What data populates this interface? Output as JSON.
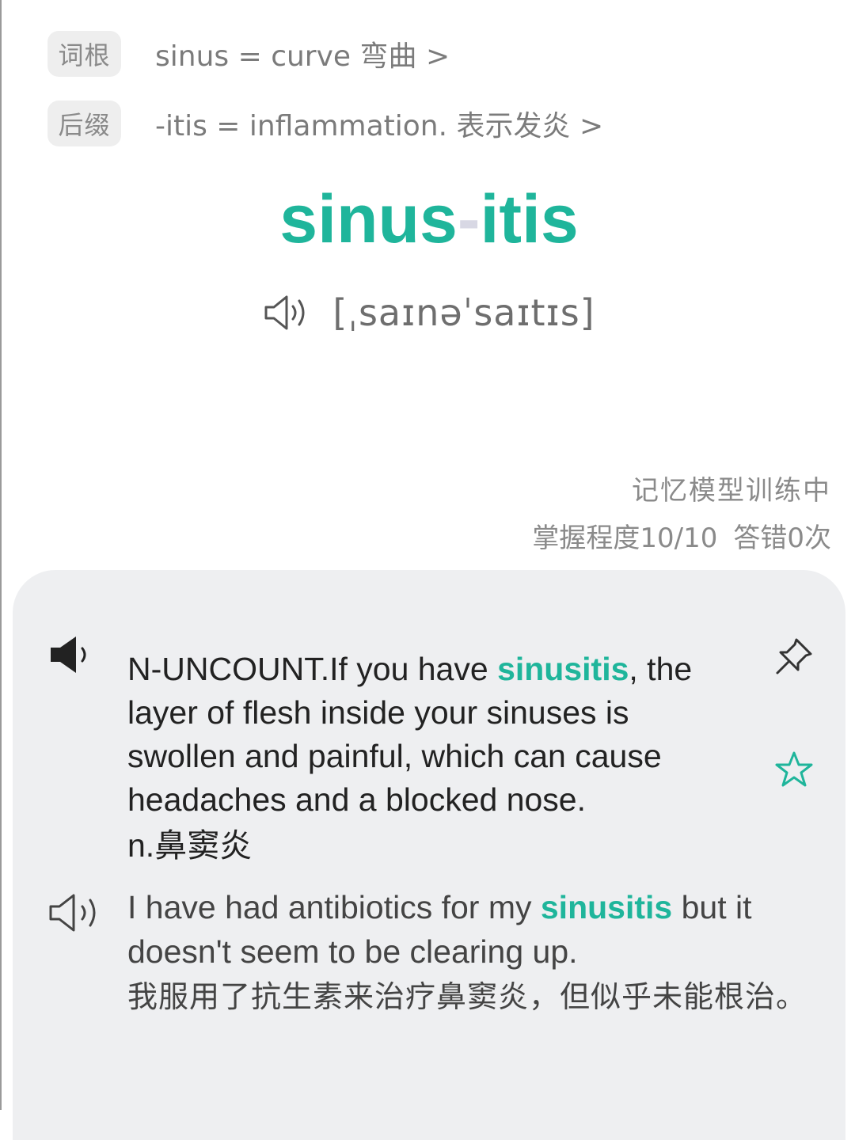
{
  "morphology": {
    "root": {
      "tag": "词根",
      "text": "sinus = curve 弯曲 >"
    },
    "suffix": {
      "tag": "后缀",
      "text": "-itis = inflammation. 表示发炎 >"
    }
  },
  "word": {
    "part1": "sinus",
    "separator": "-",
    "part2": "itis"
  },
  "pronunciation": {
    "phonetic": "[ˌsaɪnəˈsaɪtɪs]",
    "icon": "speaker-icon"
  },
  "status": {
    "line1": "记忆模型训练中",
    "mastery": "掌握程度10/10",
    "errors": "答错0次"
  },
  "definition": {
    "prefix": "N-UNCOUNT.If you have ",
    "highlight": "sinusitis",
    "suffix": ", the layer of flesh inside your sinuses is swollen and painful, which can cause headaches and a blocked nose.",
    "chinese": "n.鼻窦炎"
  },
  "example": {
    "prefix": "I have had antibiotics for my ",
    "highlight": "sinusitis",
    "suffix": " but it doesn't seem to be clearing up.",
    "chinese": "我服用了抗生素来治疗鼻窦炎，但似乎未能根治。"
  },
  "colors": {
    "accent": "#1fb59b",
    "card_bg": "#eeeff1",
    "tag_bg": "#eeeeee"
  },
  "icons": {
    "definition_audio": "speaker-filled-icon",
    "pin": "pin-icon",
    "favorite": "star-icon",
    "example_audio": "speaker-icon"
  }
}
